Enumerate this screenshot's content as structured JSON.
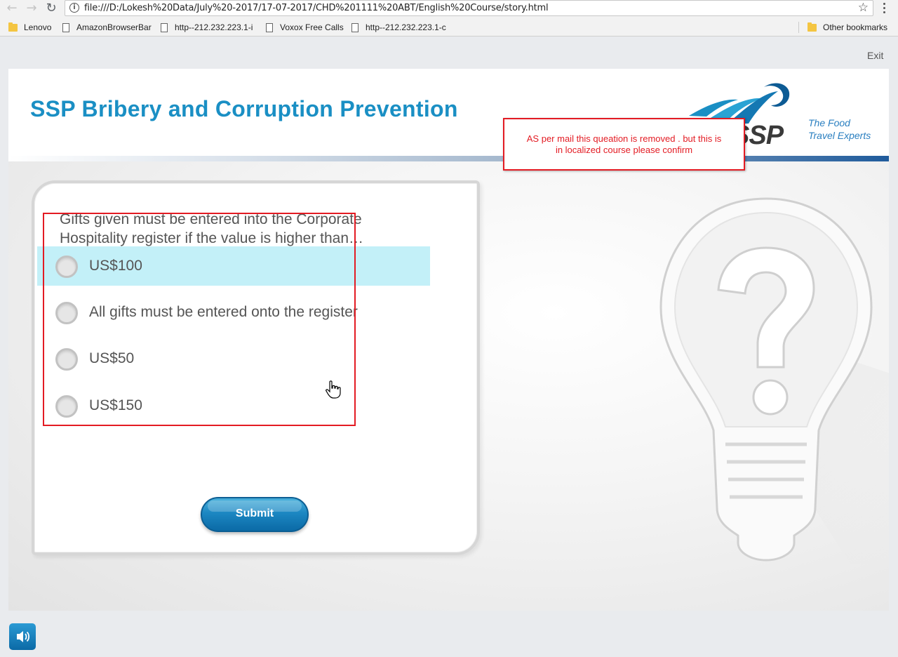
{
  "browser": {
    "url": "file:///D:/Lokesh%20Data/July%20-2017/17-07-2017/CHD%201111%20ABT/English%20Course/story.html",
    "bookmarks": [
      {
        "label": "Lenovo",
        "type": "folder"
      },
      {
        "label": "AmazonBrowserBar",
        "type": "page"
      },
      {
        "label": "http--212.232.223.1-i",
        "type": "page"
      },
      {
        "label": "Voxox Free Calls",
        "type": "page"
      },
      {
        "label": "http--212.232.223.1-c",
        "type": "page"
      }
    ],
    "other_bookmarks": "Other bookmarks"
  },
  "player": {
    "exit_label": "Exit"
  },
  "slide": {
    "course_title": "SSP Bribery and Corruption Prevention",
    "logo": {
      "brand": "SSP",
      "tagline_line1": "The Food",
      "tagline_line2": "Travel Experts"
    },
    "question": "Gifts given must be entered into the Corporate Hospitality register if the value is higher than…",
    "options": [
      {
        "label": "US$100",
        "hovered": true
      },
      {
        "label": "All gifts must be entered onto the register",
        "hovered": false
      },
      {
        "label": "US$50",
        "hovered": false
      },
      {
        "label": "US$150",
        "hovered": false
      }
    ],
    "submit_label": "Submit"
  },
  "annotation": {
    "line1": "AS per mail this queation is removed . but this is",
    "line2": "in localized course please confirm",
    "color": "#e31b23"
  },
  "colors": {
    "accent": "#1a8fc4",
    "hover": "#c3f0f8",
    "button": "#1c87c2"
  }
}
